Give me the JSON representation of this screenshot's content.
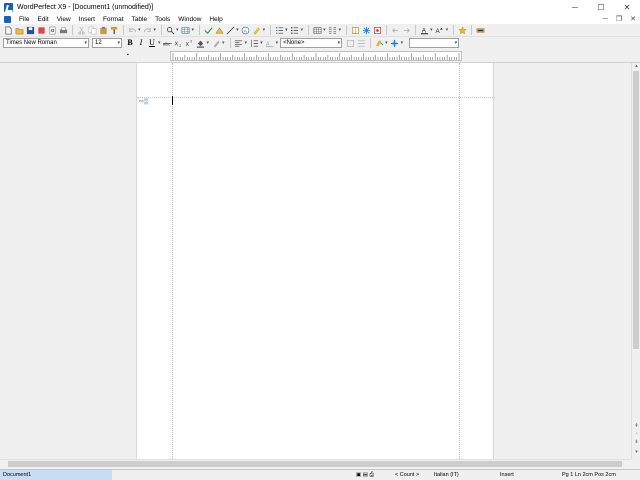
{
  "window": {
    "title": "WordPerfect X9 - [Document1 (unmodified)]",
    "controls": {
      "minimize": "─",
      "maximize": "☐",
      "close": "✕"
    }
  },
  "menubar": {
    "items": [
      "File",
      "Edit",
      "View",
      "Insert",
      "Format",
      "Table",
      "Tools",
      "Window",
      "Help"
    ],
    "mdi": {
      "minimize": "─",
      "restore": "❐",
      "close": "✕"
    }
  },
  "propertybar": {
    "font": "Times New Roman",
    "size": "12",
    "style": "<None>"
  },
  "statusbar": {
    "document": "Document1",
    "count": "< Count >",
    "language": "Italian (IT)",
    "mode": "Insert",
    "position": "Pg 1 Ln 2cm Pos 2cm"
  },
  "colors": {
    "accent": "#1e5fb4",
    "status_highlight": "#c8dcf4"
  }
}
